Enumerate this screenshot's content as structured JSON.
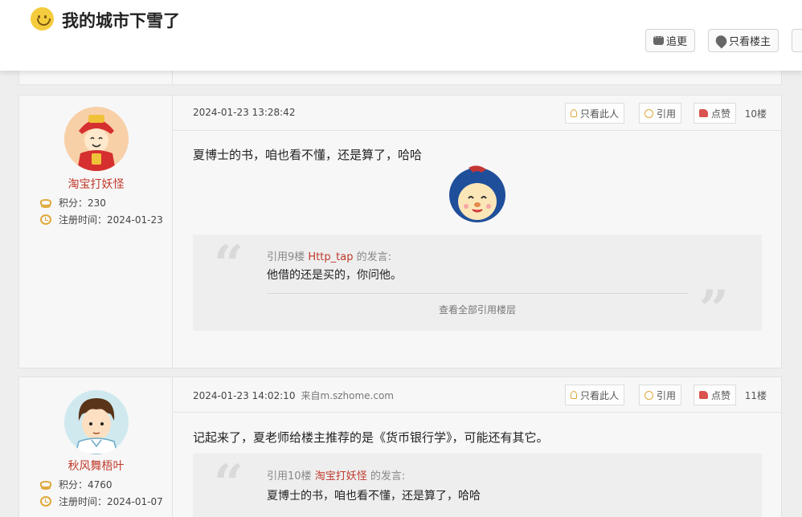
{
  "header": {
    "title": "我的城市下雪了",
    "buttons": [
      {
        "label": "追更",
        "icon": "chat-icon"
      },
      {
        "label": "只看楼主",
        "icon": "drop-icon"
      }
    ]
  },
  "posts": [
    {
      "user": {
        "name": "淘宝打妖怪",
        "points": "积分：230",
        "registered": "注册时间：2024-01-23"
      },
      "date": "2024-01-23 13:28:42",
      "source": "",
      "actions": {
        "only_this": "只看此人",
        "quote": "引用",
        "like": "点赞"
      },
      "floor": "10楼",
      "content": "夏博士的书，咱也看不懂，还是算了，哈哈",
      "quote": {
        "prefix": "引用9楼",
        "name": "Http_tap",
        "suffix": "的发言:",
        "text": "他借的还是买的，你问他。",
        "view_all": "查看全部引用楼层"
      }
    },
    {
      "user": {
        "name": "秋风舞梧叶",
        "points": "积分：4760",
        "registered": "注册时间：2024-01-07"
      },
      "date": "2024-01-23 14:02:10",
      "source": "来自m.szhome.com",
      "actions": {
        "only_this": "只看此人",
        "quote": "引用",
        "like": "点赞"
      },
      "floor": "11楼",
      "content": "记起来了，夏老师给楼主推荐的是《货币银行学》，可能还有其它。",
      "quote": {
        "prefix": "引用10楼",
        "name": "淘宝打妖怪",
        "suffix": "的发言:",
        "text": "夏博士的书，咱也看不懂，还是算了，哈哈"
      }
    }
  ],
  "colors": {
    "accent": "#c0392b",
    "icon": "#e0a93b",
    "like": "#d9534f"
  }
}
